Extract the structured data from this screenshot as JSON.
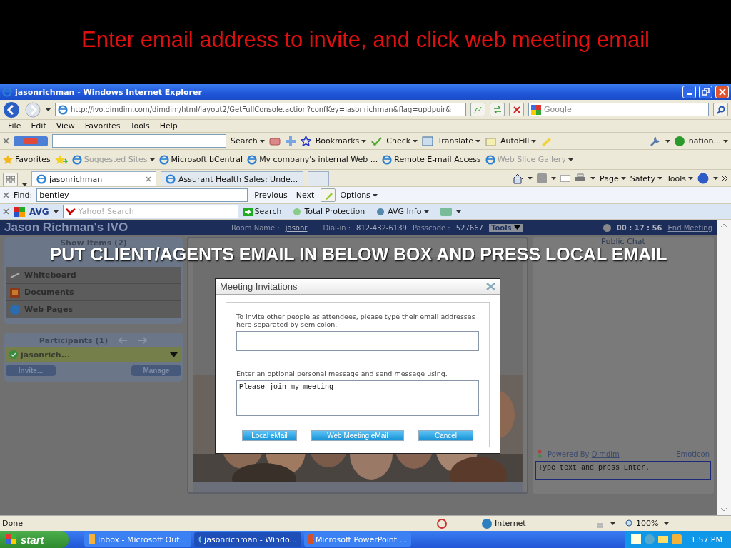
{
  "slide_title": "Enter email address to invite, and click web meeting email",
  "window": {
    "title": "jasonrichman - Windows Internet Explorer"
  },
  "address_bar": {
    "url": "http://ivo.dimdim.com/dimdim/html/layout2/GetFullConsole.action?confKey=jasonrichman&flag=updpuir&",
    "search_placeholder": "Google"
  },
  "menu": [
    "File",
    "Edit",
    "View",
    "Favorites",
    "Tools",
    "Help"
  ],
  "google_toolbar": {
    "search": "Search",
    "items": [
      "Bookmarks",
      "Check",
      "Translate",
      "AutoFill"
    ],
    "account": "nation..."
  },
  "favorites_bar": {
    "label": "Favorites",
    "links": [
      {
        "label": "Suggested Sites",
        "dimmed": true
      },
      {
        "label": "Microsoft bCentral",
        "dimmed": false
      },
      {
        "label": "My company's internal Web ...",
        "dimmed": false
      },
      {
        "label": "Remote E-mail Access",
        "dimmed": false
      },
      {
        "label": "Web Slice Gallery",
        "dimmed": true
      }
    ]
  },
  "tabs": [
    {
      "label": "jasonrichman",
      "selected": true
    },
    {
      "label": "Assurant Health Sales: Unde...",
      "selected": false
    }
  ],
  "command_bar": [
    "Page",
    "Safety",
    "Tools"
  ],
  "find_bar": {
    "label": "Find:",
    "value": "bentley",
    "buttons": [
      "Previous",
      "Next"
    ],
    "options": "Options"
  },
  "avg_toolbar": {
    "logo": "AVG",
    "search_placeholder": "Yahoo! Search",
    "search_button": "Search",
    "items": [
      "Total Protection",
      "AVG Info"
    ]
  },
  "app": {
    "title": "Jason Richman's IVO",
    "room_label": "Room Name :",
    "room": "jasonr",
    "dialin_label": "Dial-in :",
    "dialin": "812-432-6139",
    "passcode_label": "Passcode :",
    "passcode": "527667",
    "tools": "Tools",
    "timer": "00 : 17 : 56",
    "end": "End Meeting"
  },
  "show_items": {
    "title": "Show Items (2)",
    "items": [
      {
        "label": "Whiteboard"
      },
      {
        "label": "Documents"
      },
      {
        "label": "Web Pages"
      }
    ]
  },
  "participants": {
    "title": "Participants (1)",
    "people": [
      {
        "name": "jasonrich..."
      }
    ],
    "buttons": [
      "Invite...",
      "Manage"
    ]
  },
  "chat": {
    "title": "Public Chat",
    "powered_by": "Powered By",
    "powered_link": "Dimdim",
    "emoticon": "Emoticon",
    "value": "Type text and press Enter."
  },
  "dialog": {
    "title": "Meeting Invitations",
    "invite_prompt": "To invite other people as attendees, please type their email addresses here separated by semicolon.",
    "message_prompt": "Enter an optional personal message and send message using.",
    "message": "Please join my meeting",
    "buttons": [
      "Local eMail",
      "Web Meeting eMail",
      "Cancel"
    ]
  },
  "caption": "PUT CLIENT/AGENTS EMAIL IN BELOW BOX AND PRESS LOCAL EMAIL",
  "status_bar": {
    "text": "Done",
    "zone": "Internet",
    "zoom": "100%"
  },
  "taskbar": {
    "start": "start",
    "items": [
      {
        "label": "Inbox - Microsoft Out...",
        "selected": false
      },
      {
        "label": "jasonrichman - Windo...",
        "selected": true
      },
      {
        "label": "Microsoft PowerPoint ...",
        "selected": false
      }
    ],
    "clock": "1:57 PM"
  }
}
